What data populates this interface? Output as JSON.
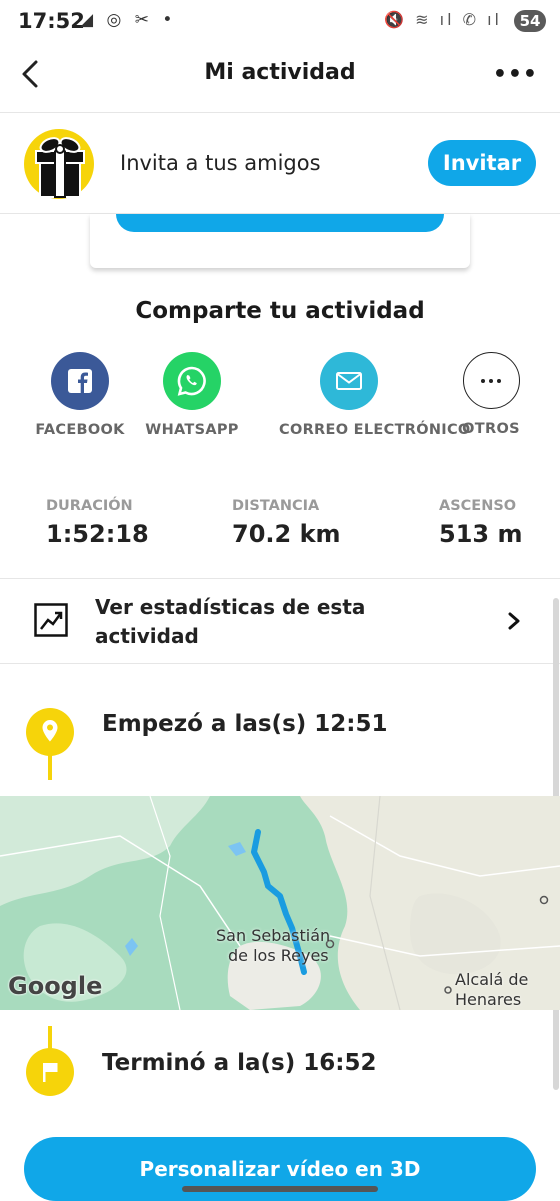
{
  "status_bar": {
    "time": "17:52",
    "left_icons": "◢ ◎ ✂ •",
    "right_icons": "🔇 ≋ ıl ✆ ıl",
    "battery": "54"
  },
  "header": {
    "title": "Mi actividad",
    "more_label": "•••"
  },
  "invite": {
    "text": "Invita a tus amigos",
    "button": "Invitar"
  },
  "share": {
    "title": "Comparte tu actividad",
    "items": [
      {
        "label": "FACEBOOK",
        "icon": "facebook-icon",
        "color": "#3b5998"
      },
      {
        "label": "WHATSAPP",
        "icon": "whatsapp-icon",
        "color": "#25d366"
      },
      {
        "label": "CORREO ELECTRÓNICO",
        "icon": "mail-icon",
        "color": "#2eb8d8"
      },
      {
        "label": "OTROS",
        "icon": "more-icon",
        "color": "#ffffff"
      }
    ]
  },
  "stats": [
    {
      "label": "DURACIÓN",
      "value": "1:52:18"
    },
    {
      "label": "DISTANCIA",
      "value": "70.2 km"
    },
    {
      "label": "ASCENSO",
      "value": "513 m"
    }
  ],
  "stats_link": {
    "text": "Ver estadísticas de esta actividad"
  },
  "timeline": {
    "start": "Empezó a las(s) 12:51",
    "end": "Terminó a la(s) 16:52"
  },
  "map": {
    "label_1_line1": "San Sebastián",
    "label_1_line2": "de los Reyes",
    "label_2_line1": "Alcalá de",
    "label_2_line2": "Henares",
    "attribution": "Google",
    "route_color": "#1a9ce0"
  },
  "bottom_button": "Personalizar vídeo en 3D"
}
